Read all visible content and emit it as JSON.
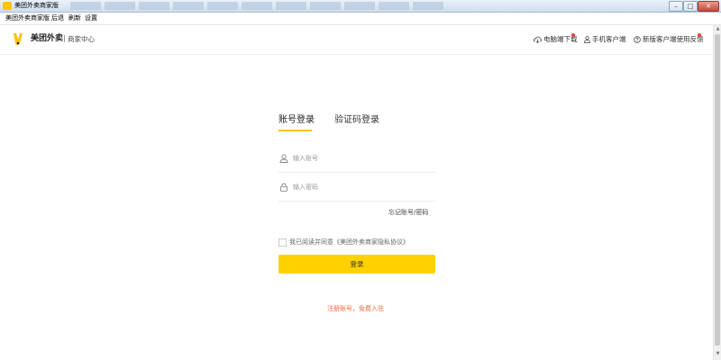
{
  "window": {
    "title": "美团外卖商家版",
    "controls": {
      "minimize": "–",
      "maximize": "□",
      "close": "✕"
    }
  },
  "menu": {
    "items": [
      "美团外卖商家版",
      "后退",
      "刷新",
      "设置"
    ]
  },
  "header": {
    "brand": "美团外卖",
    "subtitle": "商家中心",
    "links": {
      "pc_download": "电脑端下载",
      "mobile_client": "手机客户端",
      "feedback": "新版客户端使用反馈"
    }
  },
  "login": {
    "tabs": {
      "account": "账号登录",
      "sms": "验证码登录"
    },
    "account_placeholder": "输入账号",
    "password_placeholder": "输入密码",
    "forgot": "忘记账号/密码",
    "agreement": "我已阅读并同意《美团外卖商家隐私协议》",
    "submit": "登录",
    "register": "注册账号，免费入驻"
  },
  "colors": {
    "accent": "#ffd100",
    "tab_underline": "#ffc300",
    "register_text": "#f06b3a",
    "notice_dot": "#f0402e"
  }
}
